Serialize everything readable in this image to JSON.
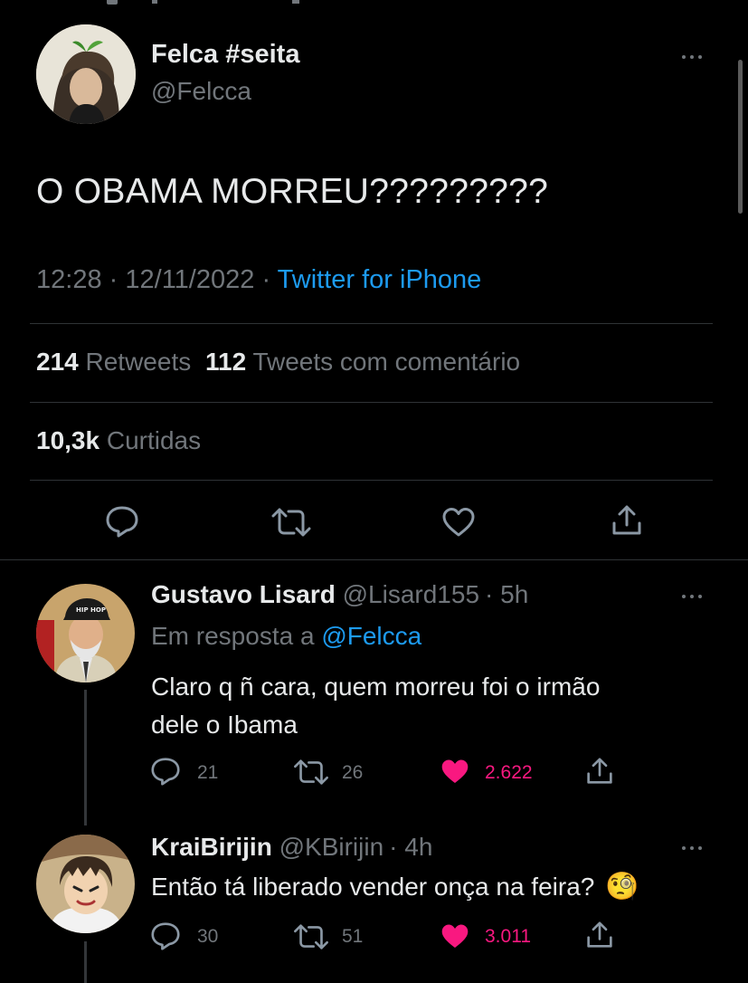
{
  "main_tweet": {
    "display_name": "Felca #seita",
    "handle": "@Felcca",
    "text": "O OBAMA MORREU?????????",
    "time": "12:28",
    "sep1": "·",
    "date": "12/11/2022",
    "sep2": "·",
    "source": "Twitter for iPhone",
    "retweets_count": "214",
    "retweets_label": "Retweets",
    "quotes_count": "112",
    "quotes_label": "Tweets com comentário",
    "likes_count": "10,3k",
    "likes_label": "Curtidas"
  },
  "replies": [
    {
      "display_name": "Gustavo Lisard",
      "handle": "@Lisard155",
      "time": "· 5h",
      "reply_prefix": "Em resposta a",
      "reply_to": "@Felcca",
      "text_line1": "Claro q ñ cara, quem morreu foi o irmão",
      "text_line2": "dele o Ibama",
      "reply_count": "21",
      "retweet_count": "26",
      "like_count": "2.622",
      "avatar_cap_text": "HIP HOP"
    },
    {
      "display_name": "KraiBirijin",
      "handle": "@KBirijin",
      "time": "· 4h",
      "text": "Então tá liberado vender onça na feira?",
      "emoji": "🧐",
      "reply_count": "30",
      "retweet_count": "51",
      "like_count": "3.011"
    }
  ],
  "colors": {
    "background": "#000000",
    "text": "#e7e9ea",
    "muted": "#71767b",
    "link": "#1d9bf0",
    "like_active": "#f91880",
    "divider": "#2f3336"
  }
}
